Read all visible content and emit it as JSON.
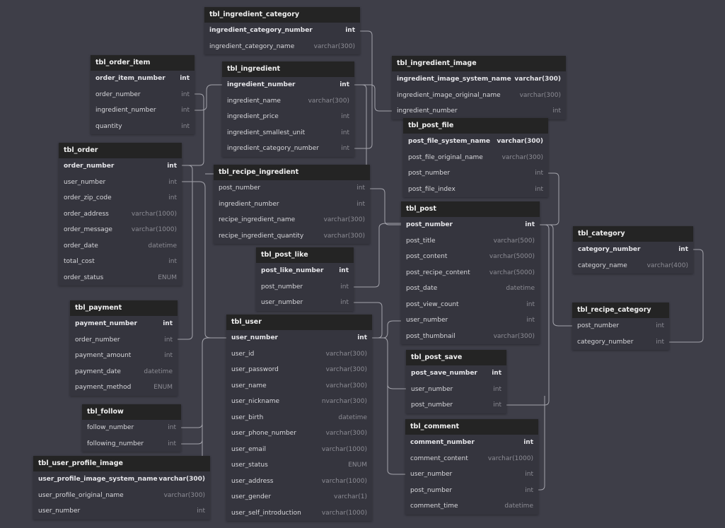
{
  "tables": [
    {
      "name": "tbl_ingredient_category",
      "columns": [
        {
          "name": "ingredient_category_number",
          "type": "int",
          "pk": true
        },
        {
          "name": "ingredient_category_name",
          "type": "varchar(300)"
        }
      ]
    },
    {
      "name": "tbl_order_item",
      "columns": [
        {
          "name": "order_item_number",
          "type": "int",
          "pk": true
        },
        {
          "name": "order_number",
          "type": "int"
        },
        {
          "name": "ingredient_number",
          "type": "int"
        },
        {
          "name": "quantity",
          "type": "int"
        }
      ]
    },
    {
      "name": "tbl_ingredient",
      "columns": [
        {
          "name": "ingredient_number",
          "type": "int",
          "pk": true
        },
        {
          "name": "ingredient_name",
          "type": "varchar(300)"
        },
        {
          "name": "ingredient_price",
          "type": "int"
        },
        {
          "name": "ingredient_smallest_unit",
          "type": "int"
        },
        {
          "name": "ingredient_category_number",
          "type": "int"
        }
      ]
    },
    {
      "name": "tbl_ingredient_image",
      "columns": [
        {
          "name": "ingredient_image_system_name",
          "type": "varchar(300)",
          "pk": true
        },
        {
          "name": "ingredient_image_original_name",
          "type": "varchar(300)"
        },
        {
          "name": "ingredient_number",
          "type": "int"
        }
      ]
    },
    {
      "name": "tbl_post_file",
      "columns": [
        {
          "name": "post_file_system_name",
          "type": "varchar(300)",
          "pk": true
        },
        {
          "name": "post_file_original_name",
          "type": "varchar(300)"
        },
        {
          "name": "post_number",
          "type": "int"
        },
        {
          "name": "post_file_index",
          "type": "int"
        }
      ]
    },
    {
      "name": "tbl_order",
      "columns": [
        {
          "name": "order_number",
          "type": "int",
          "pk": true
        },
        {
          "name": "user_number",
          "type": "int"
        },
        {
          "name": "order_zip_code",
          "type": "int"
        },
        {
          "name": "order_address",
          "type": "varchar(1000)"
        },
        {
          "name": "order_message",
          "type": "varchar(1000)"
        },
        {
          "name": "order_date",
          "type": "datetime"
        },
        {
          "name": "total_cost",
          "type": "int"
        },
        {
          "name": "order_status",
          "type": "ENUM"
        }
      ]
    },
    {
      "name": "tbl_recipe_ingredient",
      "columns": [
        {
          "name": "post_number",
          "type": "int"
        },
        {
          "name": "ingredient_number",
          "type": "int"
        },
        {
          "name": "recipe_ingredient_name",
          "type": "varchar(300)"
        },
        {
          "name": "recipe_ingredient_quantity",
          "type": "varchar(300)"
        }
      ]
    },
    {
      "name": "tbl_post",
      "columns": [
        {
          "name": "post_number",
          "type": "int",
          "pk": true
        },
        {
          "name": "post_title",
          "type": "varchar(500)"
        },
        {
          "name": "post_content",
          "type": "varchar(5000)"
        },
        {
          "name": "post_recipe_content",
          "type": "varchar(5000)"
        },
        {
          "name": "post_date",
          "type": "datetime"
        },
        {
          "name": "post_view_count",
          "type": "int"
        },
        {
          "name": "user_number",
          "type": "int"
        },
        {
          "name": "post_thumbnail",
          "type": "varchar(300)"
        }
      ]
    },
    {
      "name": "tbl_category",
      "columns": [
        {
          "name": "category_number",
          "type": "int",
          "pk": true
        },
        {
          "name": "category_name",
          "type": "varchar(400)"
        }
      ]
    },
    {
      "name": "tbl_post_like",
      "columns": [
        {
          "name": "post_like_number",
          "type": "int",
          "pk": true
        },
        {
          "name": "post_number",
          "type": "int"
        },
        {
          "name": "user_number",
          "type": "int"
        }
      ]
    },
    {
      "name": "tbl_recipe_category",
      "columns": [
        {
          "name": "post_number",
          "type": "int"
        },
        {
          "name": "category_number",
          "type": "int"
        }
      ]
    },
    {
      "name": "tbl_payment",
      "columns": [
        {
          "name": "payment_number",
          "type": "int",
          "pk": true
        },
        {
          "name": "order_number",
          "type": "int"
        },
        {
          "name": "payment_amount",
          "type": "int"
        },
        {
          "name": "payment_date",
          "type": "datetime"
        },
        {
          "name": "payment_method",
          "type": "ENUM"
        }
      ]
    },
    {
      "name": "tbl_user",
      "columns": [
        {
          "name": "user_number",
          "type": "int",
          "pk": true
        },
        {
          "name": "user_id",
          "type": "varchar(300)"
        },
        {
          "name": "user_password",
          "type": "varchar(300)"
        },
        {
          "name": "user_name",
          "type": "varchar(300)"
        },
        {
          "name": "user_nickname",
          "type": "nvarchar(300)"
        },
        {
          "name": "user_birth",
          "type": "datetime"
        },
        {
          "name": "user_phone_number",
          "type": "varchar(300)"
        },
        {
          "name": "user_email",
          "type": "varchar(1000)"
        },
        {
          "name": "user_status",
          "type": "ENUM"
        },
        {
          "name": "user_address",
          "type": "varchar(1000)"
        },
        {
          "name": "user_gender",
          "type": "varchar(1)"
        },
        {
          "name": "user_self_introduction",
          "type": "varchar(1000)"
        }
      ]
    },
    {
      "name": "tbl_post_save",
      "columns": [
        {
          "name": "post_save_number",
          "type": "int",
          "pk": true
        },
        {
          "name": "user_number",
          "type": "int"
        },
        {
          "name": "post_number",
          "type": "int"
        }
      ]
    },
    {
      "name": "tbl_follow",
      "columns": [
        {
          "name": "follow_number",
          "type": "int"
        },
        {
          "name": "following_number",
          "type": "int"
        }
      ]
    },
    {
      "name": "tbl_comment",
      "columns": [
        {
          "name": "comment_number",
          "type": "int",
          "pk": true
        },
        {
          "name": "comment_content",
          "type": "varchar(1000)"
        },
        {
          "name": "user_number",
          "type": "int"
        },
        {
          "name": "post_number",
          "type": "int"
        },
        {
          "name": "comment_time",
          "type": "datetime"
        }
      ]
    },
    {
      "name": "tbl_user_profile_image",
      "columns": [
        {
          "name": "user_profile_image_system_name",
          "type": "varchar(300)",
          "pk": true
        },
        {
          "name": "user_profile_original_name",
          "type": "varchar(300)"
        },
        {
          "name": "user_number",
          "type": "int"
        }
      ]
    }
  ]
}
